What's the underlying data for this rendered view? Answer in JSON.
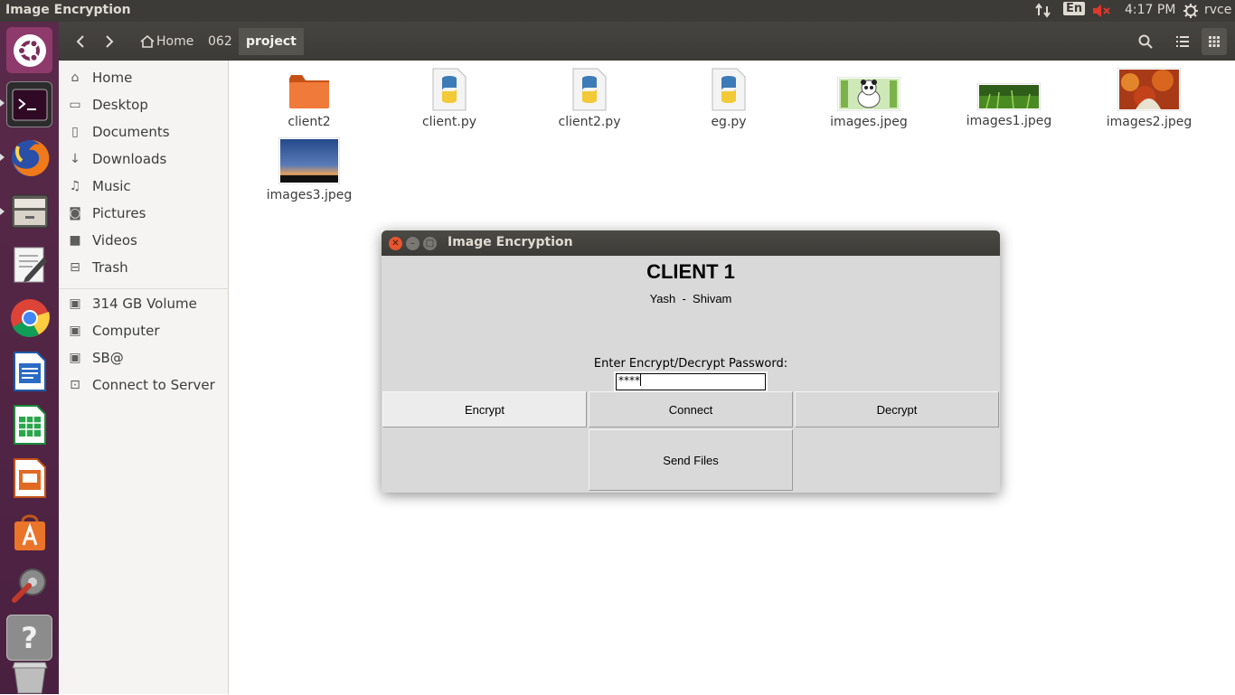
{
  "top_panel": {
    "app_title": "Image Encryption",
    "keyboard_layout": "En",
    "clock": "4:17 PM",
    "user": "rvce",
    "icons": [
      "network-updown-icon",
      "keyboard-layout-icon",
      "volume-muted-icon",
      "power-gear-icon"
    ]
  },
  "launcher": {
    "items": [
      "ubuntu-dash-icon",
      "terminal-icon",
      "firefox-icon",
      "files-icon",
      "text-editor-icon",
      "chrome-icon",
      "writer-icon",
      "calc-icon",
      "impress-icon",
      "software-center-icon",
      "system-settings-icon",
      "help-icon",
      "trash-icon"
    ]
  },
  "file_manager": {
    "breadcrumb": [
      "Home",
      "062",
      "project"
    ],
    "sidebar": {
      "places": [
        {
          "label": "Home",
          "icon": "home-icon"
        },
        {
          "label": "Desktop",
          "icon": "desktop-icon"
        },
        {
          "label": "Documents",
          "icon": "documents-icon"
        },
        {
          "label": "Downloads",
          "icon": "downloads-icon"
        },
        {
          "label": "Music",
          "icon": "music-icon"
        },
        {
          "label": "Pictures",
          "icon": "pictures-icon"
        },
        {
          "label": "Videos",
          "icon": "videos-icon"
        },
        {
          "label": "Trash",
          "icon": "trash-icon"
        }
      ],
      "devices": [
        {
          "label": "314 GB Volume",
          "icon": "drive-icon"
        },
        {
          "label": "Computer",
          "icon": "drive-icon"
        },
        {
          "label": "SB@",
          "icon": "drive-icon"
        },
        {
          "label": "Connect to Server",
          "icon": "server-icon"
        }
      ]
    },
    "files": [
      {
        "name": "client2",
        "type": "folder"
      },
      {
        "name": "client.py",
        "type": "python"
      },
      {
        "name": "client2.py",
        "type": "python"
      },
      {
        "name": "eg.py",
        "type": "python"
      },
      {
        "name": "images.jpeg",
        "type": "image-panda"
      },
      {
        "name": "images1.jpeg",
        "type": "image-grass"
      },
      {
        "name": "images2.jpeg",
        "type": "image-autumn"
      },
      {
        "name": "images3.jpeg",
        "type": "image-dusk"
      }
    ]
  },
  "dialog": {
    "title": "Image Encryption",
    "heading": "CLIENT 1",
    "subtitle": "Yash  -  Shivam",
    "password_label": "Enter Encrypt/Decrypt Password:",
    "password_value": "****",
    "buttons": {
      "encrypt": "Encrypt",
      "connect": "Connect",
      "decrypt": "Decrypt",
      "send_files": "Send Files"
    }
  }
}
